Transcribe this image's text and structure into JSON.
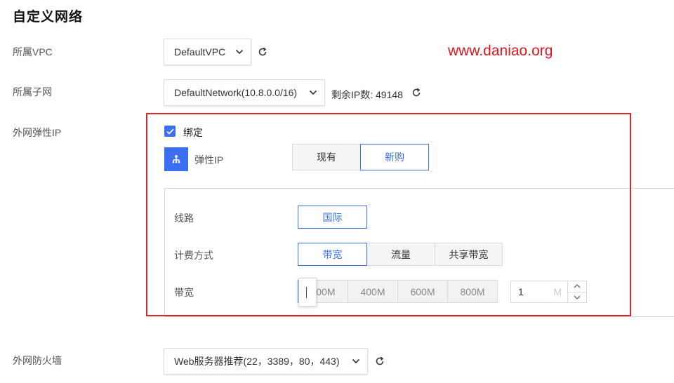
{
  "page_title": "自定义网络",
  "watermark": "www.daniao.org",
  "vpc": {
    "label": "所属VPC",
    "value": "DefaultVPC"
  },
  "subnet": {
    "label": "所属子网",
    "value": "DefaultNetwork(10.8.0.0/16)",
    "remaining_ip": "剩余IP数: 49148"
  },
  "eip": {
    "label": "外网弹性IP",
    "bind": {
      "label": "绑定",
      "checked": true
    },
    "type_label": "弹性IP",
    "source_options": [
      "现有",
      "新购"
    ],
    "source_selected": "新购",
    "line": {
      "label": "线路",
      "options": [
        "国际"
      ],
      "selected": "国际"
    },
    "billing": {
      "label": "计费方式",
      "options": [
        "带宽",
        "流量",
        "共享带宽"
      ],
      "selected": "带宽"
    },
    "bandwidth": {
      "label": "带宽",
      "ticks": [
        "200M",
        "400M",
        "600M",
        "800M"
      ],
      "value": "1",
      "unit": "M"
    }
  },
  "firewall": {
    "label": "外网防火墙",
    "value": "Web服务器推荐(22，3389，80，443)"
  },
  "colors": {
    "accent": "#3b6ef0",
    "highlight_box": "#e0262d",
    "watermark": "#e0151f"
  },
  "icons": {
    "refresh": "refresh-icon",
    "chevron": "chevron-down-icon",
    "check": "check-icon",
    "network": "network-icon"
  }
}
